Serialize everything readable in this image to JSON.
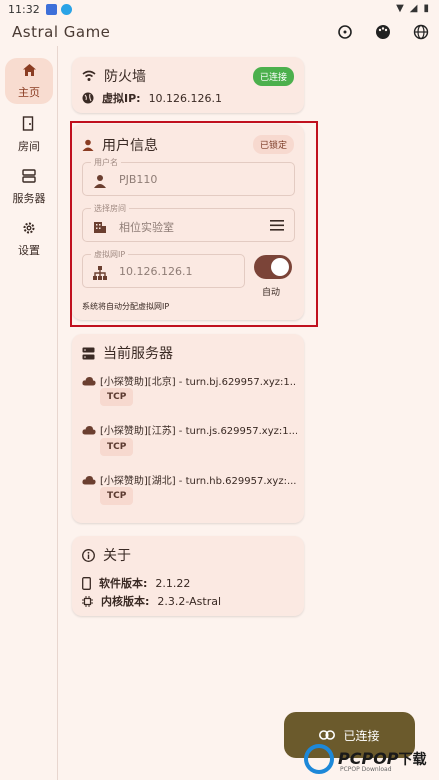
{
  "status_bar": {
    "time": "11:32"
  },
  "app": {
    "title": "Astral Game"
  },
  "rail": {
    "items": [
      {
        "label": "主页",
        "icon": "home-icon"
      },
      {
        "label": "房间",
        "icon": "room-icon"
      },
      {
        "label": "服务器",
        "icon": "server-icon"
      },
      {
        "label": "设置",
        "icon": "gear-icon"
      }
    ]
  },
  "firewall": {
    "title": "防火墙",
    "badge": "已连接",
    "ip_label": "虚拟IP:",
    "ip_value": "10.126.126.1"
  },
  "user_info": {
    "title": "用户信息",
    "badge": "已锁定",
    "username_label": "用户名",
    "username_value": "PJB110",
    "room_label": "选择房间",
    "room_value": "相位实验室",
    "vip_label": "虚拟网IP",
    "vip_value": "10.126.126.1",
    "auto_label": "自动",
    "auto_enabled": true,
    "hint": "系统将自动分配虚拟网IP"
  },
  "servers": {
    "title": "当前服务器",
    "items": [
      {
        "name": "[小探赞助][北京] - turn.bj.629957.xyz:1...",
        "protocol": "TCP"
      },
      {
        "name": "[小探赞助][江苏] - turn.js.629957.xyz:1...",
        "protocol": "TCP"
      },
      {
        "name": "[小探赞助][湖北] - turn.hb.629957.xyz:...",
        "protocol": "TCP"
      }
    ]
  },
  "about": {
    "title": "关于",
    "software_label": "软件版本:",
    "software_value": "2.1.22",
    "core_label": "内核版本:",
    "core_value": "2.3.2-Astral"
  },
  "fab": {
    "label": "已连接"
  },
  "watermark": {
    "brand": "PCPOP",
    "suffix": "下载",
    "sub": "PCPOP Download"
  },
  "colors": {
    "background": "#fdf3ee",
    "card": "#fbe9e2",
    "accent": "#7b4438",
    "connected_green": "#4cb04d",
    "fab": "#6b5a2c",
    "highlight_red": "#c0101e"
  }
}
